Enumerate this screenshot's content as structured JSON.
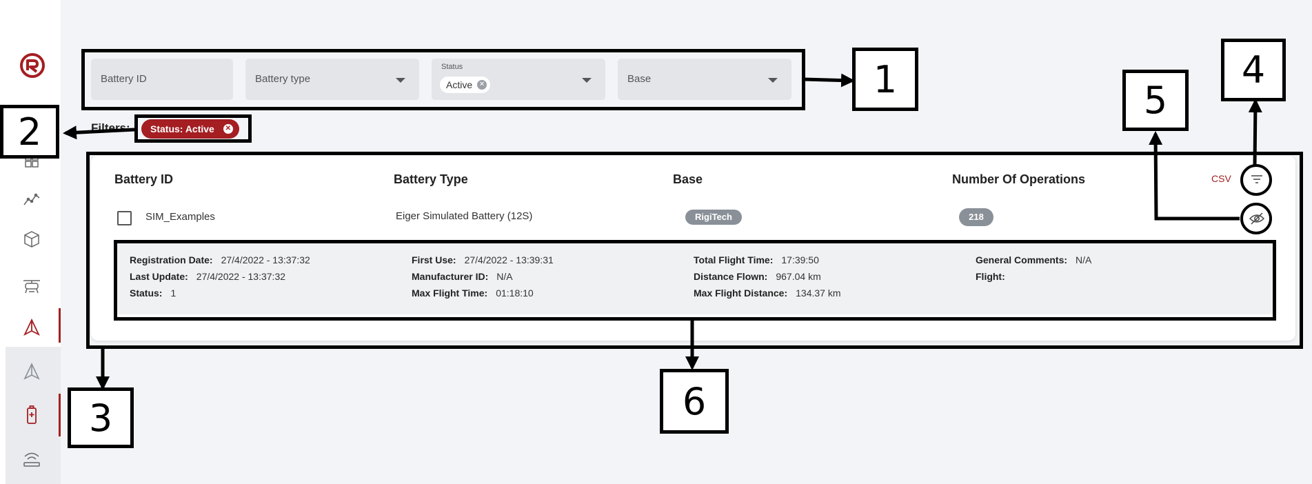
{
  "filters": {
    "battery_id_placeholder": "Battery ID",
    "battery_type_placeholder": "Battery type",
    "status_label": "Status",
    "status_value": "Active",
    "base_placeholder": "Base"
  },
  "active_filters": {
    "label": "Filters:",
    "chip": "Status: Active"
  },
  "table": {
    "headers": [
      "Battery ID",
      "Battery Type",
      "Base",
      "Number Of Operations"
    ],
    "csv_label": "CSV",
    "row": {
      "battery_id": "SIM_Examples",
      "battery_type": "Eiger Simulated Battery (12S)",
      "base": "RigiTech",
      "operations": "218"
    },
    "details": {
      "registration_date_label": "Registration Date:",
      "registration_date": "27/4/2022 - 13:37:32",
      "last_update_label": "Last Update:",
      "last_update": "27/4/2022 - 13:37:32",
      "status_label": "Status:",
      "status": "1",
      "first_use_label": "First Use:",
      "first_use": "27/4/2022 - 13:39:31",
      "manufacturer_id_label": "Manufacturer ID:",
      "manufacturer_id": "N/A",
      "max_flight_time_label": "Max Flight Time:",
      "max_flight_time": "01:18:10",
      "total_flight_time_label": "Total Flight Time:",
      "total_flight_time": "17:39:50",
      "distance_flown_label": "Distance Flown:",
      "distance_flown": "967.04 km",
      "max_flight_distance_label": "Max Flight Distance:",
      "max_flight_distance": "134.37 km",
      "general_comments_label": "General Comments:",
      "general_comments": "N/A",
      "flight_label": "Flight:"
    }
  },
  "annotations": [
    "1",
    "2",
    "3",
    "4",
    "5",
    "6"
  ],
  "colors": {
    "accent": "#a41e22",
    "pill": "#8a9098",
    "background": "#f2f4f7"
  },
  "icons": {
    "sidebar": [
      "logo-icon",
      "dashboard-icon",
      "analytics-icon",
      "cube-icon",
      "drone-icon",
      "navigation-icon",
      "navigation-outline-icon",
      "battery-icon",
      "antenna-icon"
    ],
    "toolbar": [
      "filter-icon",
      "eye-off-icon"
    ]
  }
}
